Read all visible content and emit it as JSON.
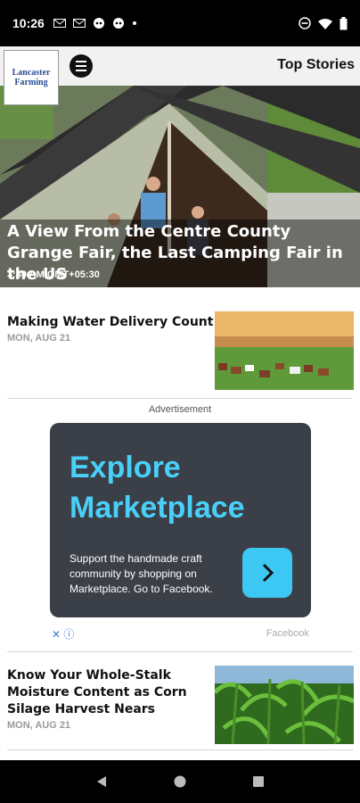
{
  "status_bar": {
    "time": "10:26",
    "left_icons": [
      "gmail-icon",
      "gmail-icon",
      "chat-icon",
      "chat-icon",
      "dot-icon"
    ],
    "right_icons": [
      "dnd-icon",
      "wifi-icon",
      "battery-icon"
    ]
  },
  "header": {
    "logo_line1": "Lancaster",
    "logo_line2": "Farming",
    "title": "Top Stories"
  },
  "hero": {
    "title": "A View From the Centre County Grange Fair, the Last Camping Fair in the US",
    "time": "3:30 AM GMT+05:30"
  },
  "articles": [
    {
      "title": "Making Water Delivery Count",
      "date": "MON, AUG 21",
      "thumb": "cows-pasture-photo"
    },
    {
      "title": "Know Your Whole-Stalk Moisture Content as Corn Silage Harvest Nears",
      "date": "MON, AUG 21",
      "thumb": "corn-field-photo"
    }
  ],
  "ad": {
    "label": "Advertisement",
    "headline_line1": "Explore",
    "headline_line2": "Marketplace",
    "body": "Support the handmade craft community by shopping on Marketplace. Go to Facebook.",
    "brand": "Facebook",
    "accent_color": "#49d0f8"
  },
  "nav": {
    "icons": [
      "back-icon",
      "home-icon",
      "recents-icon"
    ]
  }
}
